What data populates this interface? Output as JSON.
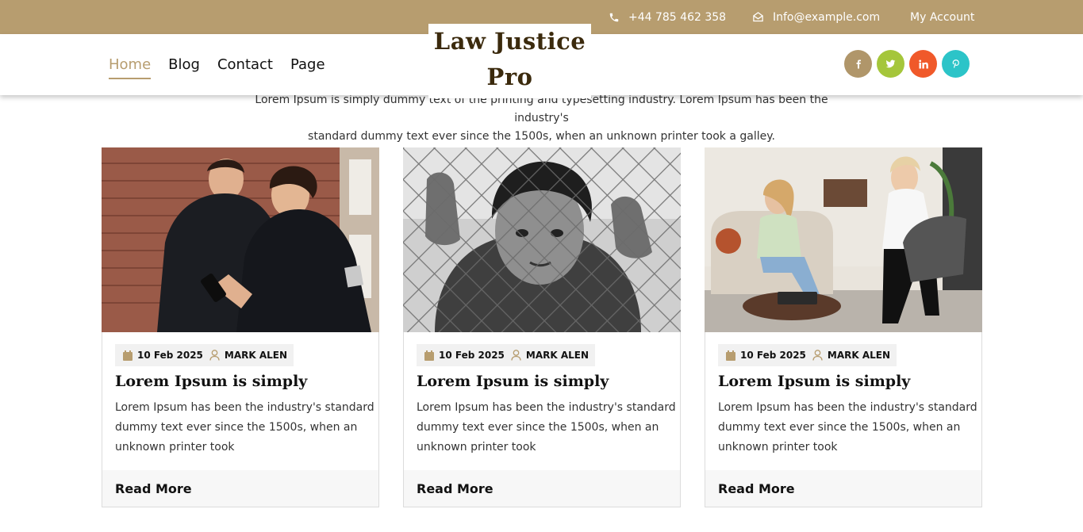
{
  "topbar": {
    "phone": "+44 785 462 358",
    "email": "Info@example.com",
    "account": "My Account",
    "phone_icon": "phone-icon",
    "email_icon": "envelope-open-icon"
  },
  "nav": {
    "items": [
      {
        "label": "Home",
        "active": true
      },
      {
        "label": "Blog",
        "active": false
      },
      {
        "label": "Contact",
        "active": false
      },
      {
        "label": "Page",
        "active": false
      }
    ]
  },
  "brand": {
    "line1": "Law Justice",
    "line2": "Pro"
  },
  "social": [
    {
      "icon": "facebook-icon",
      "color": "#b0966a"
    },
    {
      "icon": "twitter-icon",
      "color": "#a5c63b"
    },
    {
      "icon": "linkedin-icon",
      "color": "#f0592a"
    },
    {
      "icon": "pinterest-icon",
      "color": "#2cc4c8"
    }
  ],
  "intro": {
    "line1": "Lorem Ipsum is simply dummy text of the printing and typesetting industry. Lorem Ipsum has been the industry's",
    "line2": "standard dummy text ever since the 1500s, when an unknown printer took a galley."
  },
  "posts": [
    {
      "image": "police-officers-with-phone-photo",
      "date": "10 Feb 2025",
      "author": "MARK ALEN",
      "title": "Lorem Ipsum is simply",
      "excerpt": "Lorem Ipsum has been the industry's standard dummy text ever since the 1500s, when an unknown printer took",
      "read_more": "Read More"
    },
    {
      "image": "boy-behind-chain-fence-photo",
      "date": "10 Feb 2025",
      "author": "MARK ALEN",
      "title": "Lorem Ipsum is simply",
      "excerpt": "Lorem Ipsum has been the industry's standard dummy text ever since the 1500s, when an unknown printer took",
      "read_more": "Read More"
    },
    {
      "image": "counseling-session-photo",
      "date": "10 Feb 2025",
      "author": "MARK ALEN",
      "title": "Lorem Ipsum is simply",
      "excerpt": "Lorem Ipsum has been the industry's standard dummy text ever since the 1500s, when an unknown printer took",
      "read_more": "Read More"
    }
  ],
  "colors": {
    "accent": "#b79d6f",
    "brand_text": "#3b2a0d"
  }
}
